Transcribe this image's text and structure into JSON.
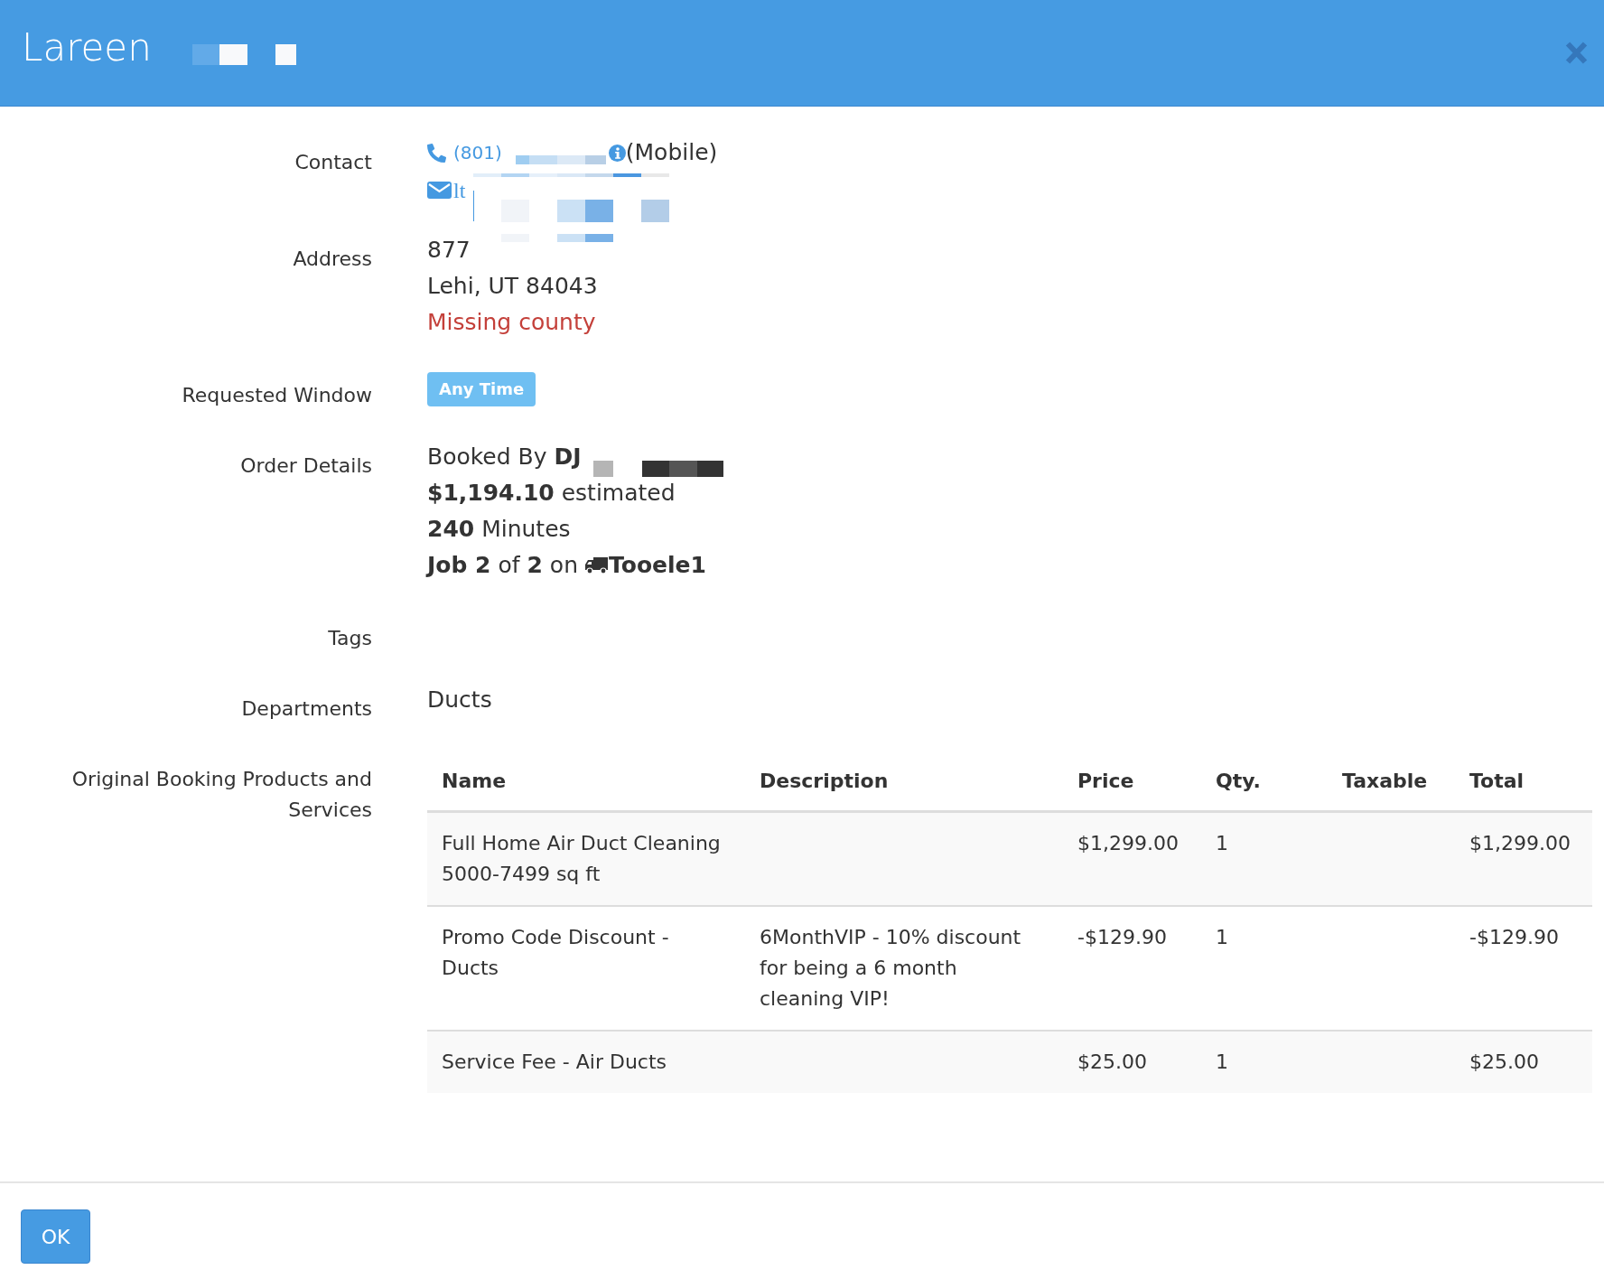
{
  "dialog": {
    "title": "Lareen"
  },
  "fields": [
    {
      "kind": "contact",
      "label": "Contact",
      "phone": "(801)",
      "phone_type": "(Mobile)",
      "email": "lt"
    },
    {
      "kind": "lines",
      "label": "Address",
      "lines": [
        {
          "text": "877",
          "kind": "normal"
        },
        {
          "text": "Lehi, UT 84043",
          "kind": "normal"
        },
        {
          "text": "Missing county",
          "kind": "warning"
        }
      ]
    },
    {
      "kind": "badge",
      "label": "Requested Window",
      "badge": "Any Time"
    },
    {
      "kind": "order",
      "label": "Order Details",
      "lines": [
        "Booked By **DJ**",
        "**$1,194.10** estimated",
        "**240** Minutes"
      ],
      "job": {
        "text": "**Job 2** of **2** on",
        "truck": "Tooele1"
      }
    },
    {
      "kind": "empty",
      "label": "Tags"
    },
    {
      "kind": "lines",
      "label": "Departments",
      "lines": [
        {
          "text": "Ducts",
          "kind": "normal"
        }
      ]
    },
    {
      "kind": "table",
      "label": "Original Booking Products and Services",
      "columns": [
        "Name",
        "Description",
        "Price",
        "Qty.",
        "Taxable",
        "Total"
      ],
      "rows": [
        {
          "name": "Full Home Air Duct Cleaning 5000-7499 sq ft",
          "price": "$1,299.00",
          "qty": "1",
          "total": "$1,299.00"
        },
        {
          "name": "Promo Code Discount - Ducts",
          "description": "6MonthVIP - 10% discount for being a 6 month cleaning VIP!",
          "price": "-$129.90",
          "qty": "1",
          "total": "-$129.90"
        },
        {
          "name": "Service Fee - Air Ducts",
          "price": "$25.00",
          "qty": "1",
          "total": "$25.00"
        }
      ]
    }
  ],
  "footer": {
    "ok_button": "OK"
  }
}
